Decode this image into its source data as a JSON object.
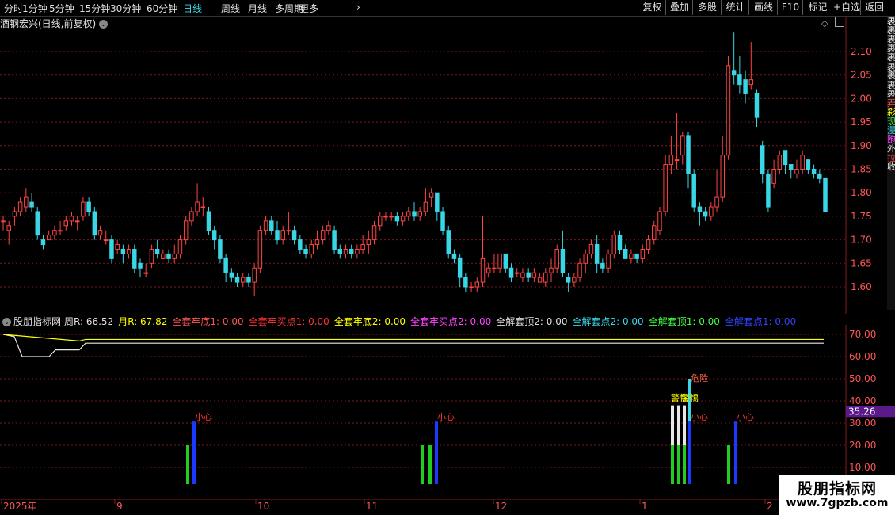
{
  "toolbar": {
    "periods": [
      "分时",
      "1分钟",
      "5分钟",
      "15分钟",
      "30分钟",
      "60分钟",
      "日线",
      "周线",
      "月线",
      "多周期",
      "更多"
    ],
    "active": "日线",
    "more_arrow": "›",
    "right_buttons": [
      "复权",
      "叠加",
      "多股",
      "统计",
      "画线",
      "F10",
      "标记",
      "+自选",
      "返回"
    ]
  },
  "main_chart": {
    "title": "酒钢宏兴(日线,前复权)",
    "price_ticks": [
      "2.10",
      "2.05",
      "2.00",
      "1.95",
      "1.90",
      "1.85",
      "1.80",
      "1.75",
      "1.70",
      "1.65",
      "1.60"
    ],
    "side_text": "裹裹裹裹裹裹裹裹裹弄彩现漫跑外拉收"
  },
  "indicator": {
    "name": "股朋指标网",
    "fields": [
      {
        "label": "周R: 66.52",
        "color": "#e0e0e0"
      },
      {
        "label": "月R: 67.82",
        "color": "#ffff00"
      },
      {
        "label": "全套牢底1: 0.00",
        "color": "#ff5555"
      },
      {
        "label": "全套牢买点1: 0.00",
        "color": "#ff3333"
      },
      {
        "label": "全套牢底2: 0.00",
        "color": "#ffff00"
      },
      {
        "label": "全套牢买点2: 0.00",
        "color": "#ff44ff"
      },
      {
        "label": "全解套顶2: 0.00",
        "color": "#e0e0e0"
      },
      {
        "label": "全解套点2: 0.00",
        "color": "#39d7e6"
      },
      {
        "label": "全解套顶1: 0.00",
        "color": "#44ff44"
      },
      {
        "label": "全解套点1: 0.00",
        "color": "#3344ff"
      }
    ],
    "ticks": [
      "70.00",
      "60.00",
      "50.00",
      "40.00",
      "30.00",
      "20.00",
      "10.00"
    ],
    "current_value": "35.26",
    "labels": {
      "careful": "小心",
      "danger": "危险",
      "alert": "警惕"
    }
  },
  "date_axis": {
    "labels": [
      "2025年",
      "9",
      "10",
      "11",
      "12",
      "1",
      "2"
    ]
  },
  "watermark": {
    "line1": "股朋指标网",
    "line2": "www.7gpzb.com"
  },
  "colors": {
    "up": "#ff4444",
    "down": "#39d7e6",
    "grid": "#7a1a1a",
    "yellow": "#ffff00",
    "white": "#e8e8e8",
    "green": "#22cc22",
    "blue": "#1a3aff"
  },
  "chart_data": {
    "type": "candlestick",
    "ylim": [
      1.57,
      2.14
    ],
    "candles": [
      [
        1.74,
        1.74,
        1.72,
        1.75
      ],
      [
        1.72,
        1.73,
        1.69,
        1.74
      ],
      [
        1.75,
        1.76,
        1.73,
        1.77
      ],
      [
        1.76,
        1.78,
        1.75,
        1.79
      ],
      [
        1.77,
        1.79,
        1.76,
        1.81
      ],
      [
        1.78,
        1.77,
        1.76,
        1.8
      ],
      [
        1.76,
        1.71,
        1.7,
        1.77
      ],
      [
        1.7,
        1.69,
        1.68,
        1.71
      ],
      [
        1.7,
        1.71,
        1.7,
        1.72
      ],
      [
        1.71,
        1.72,
        1.7,
        1.73
      ],
      [
        1.72,
        1.72,
        1.71,
        1.74
      ],
      [
        1.73,
        1.74,
        1.72,
        1.75
      ],
      [
        1.74,
        1.75,
        1.73,
        1.76
      ],
      [
        1.74,
        1.74,
        1.72,
        1.75
      ],
      [
        1.75,
        1.78,
        1.74,
        1.79
      ],
      [
        1.78,
        1.76,
        1.75,
        1.79
      ],
      [
        1.76,
        1.71,
        1.7,
        1.77
      ],
      [
        1.71,
        1.72,
        1.7,
        1.73
      ],
      [
        1.7,
        1.7,
        1.69,
        1.72
      ],
      [
        1.7,
        1.66,
        1.65,
        1.71
      ],
      [
        1.68,
        1.69,
        1.67,
        1.7
      ],
      [
        1.68,
        1.67,
        1.65,
        1.69
      ],
      [
        1.67,
        1.68,
        1.66,
        1.69
      ],
      [
        1.68,
        1.64,
        1.63,
        1.69
      ],
      [
        1.65,
        1.64,
        1.62,
        1.66
      ],
      [
        1.63,
        1.63,
        1.62,
        1.65
      ],
      [
        1.65,
        1.68,
        1.64,
        1.69
      ],
      [
        1.68,
        1.67,
        1.66,
        1.7
      ],
      [
        1.66,
        1.67,
        1.66,
        1.68
      ],
      [
        1.67,
        1.66,
        1.65,
        1.68
      ],
      [
        1.66,
        1.67,
        1.65,
        1.69
      ],
      [
        1.67,
        1.7,
        1.66,
        1.71
      ],
      [
        1.7,
        1.74,
        1.69,
        1.75
      ],
      [
        1.74,
        1.76,
        1.73,
        1.77
      ],
      [
        1.76,
        1.78,
        1.75,
        1.82
      ],
      [
        1.77,
        1.77,
        1.75,
        1.79
      ],
      [
        1.76,
        1.72,
        1.71,
        1.77
      ],
      [
        1.72,
        1.7,
        1.68,
        1.73
      ],
      [
        1.7,
        1.66,
        1.65,
        1.71
      ],
      [
        1.66,
        1.63,
        1.61,
        1.67
      ],
      [
        1.63,
        1.62,
        1.61,
        1.64
      ],
      [
        1.62,
        1.61,
        1.6,
        1.63
      ],
      [
        1.61,
        1.62,
        1.6,
        1.63
      ],
      [
        1.62,
        1.61,
        1.6,
        1.63
      ],
      [
        1.61,
        1.64,
        1.58,
        1.65
      ],
      [
        1.64,
        1.72,
        1.63,
        1.73
      ],
      [
        1.72,
        1.74,
        1.71,
        1.75
      ],
      [
        1.74,
        1.72,
        1.71,
        1.75
      ],
      [
        1.72,
        1.7,
        1.69,
        1.74
      ],
      [
        1.7,
        1.72,
        1.69,
        1.73
      ],
      [
        1.72,
        1.72,
        1.71,
        1.76
      ],
      [
        1.72,
        1.7,
        1.69,
        1.73
      ],
      [
        1.7,
        1.68,
        1.67,
        1.71
      ],
      [
        1.68,
        1.67,
        1.66,
        1.69
      ],
      [
        1.67,
        1.69,
        1.66,
        1.7
      ],
      [
        1.69,
        1.7,
        1.68,
        1.72
      ],
      [
        1.7,
        1.72,
        1.69,
        1.73
      ],
      [
        1.72,
        1.73,
        1.71,
        1.74
      ],
      [
        1.72,
        1.68,
        1.67,
        1.73
      ],
      [
        1.68,
        1.67,
        1.66,
        1.69
      ],
      [
        1.67,
        1.68,
        1.66,
        1.69
      ],
      [
        1.68,
        1.67,
        1.66,
        1.69
      ],
      [
        1.67,
        1.68,
        1.66,
        1.69
      ],
      [
        1.68,
        1.69,
        1.67,
        1.71
      ],
      [
        1.69,
        1.7,
        1.67,
        1.72
      ],
      [
        1.7,
        1.73,
        1.69,
        1.74
      ],
      [
        1.73,
        1.75,
        1.72,
        1.76
      ],
      [
        1.75,
        1.75,
        1.74,
        1.76
      ],
      [
        1.75,
        1.75,
        1.74,
        1.76
      ],
      [
        1.75,
        1.74,
        1.73,
        1.76
      ],
      [
        1.74,
        1.75,
        1.73,
        1.76
      ],
      [
        1.75,
        1.76,
        1.74,
        1.77
      ],
      [
        1.76,
        1.75,
        1.74,
        1.78
      ],
      [
        1.75,
        1.76,
        1.74,
        1.77
      ],
      [
        1.76,
        1.78,
        1.75,
        1.81
      ],
      [
        1.79,
        1.8,
        1.77,
        1.81
      ],
      [
        1.8,
        1.76,
        1.74,
        1.8
      ],
      [
        1.76,
        1.72,
        1.71,
        1.77
      ],
      [
        1.72,
        1.67,
        1.66,
        1.73
      ],
      [
        1.67,
        1.66,
        1.65,
        1.68
      ],
      [
        1.66,
        1.62,
        1.6,
        1.67
      ],
      [
        1.62,
        1.6,
        1.59,
        1.63
      ],
      [
        1.6,
        1.6,
        1.59,
        1.61
      ],
      [
        1.6,
        1.61,
        1.59,
        1.62
      ],
      [
        1.61,
        1.66,
        1.6,
        1.75
      ],
      [
        1.63,
        1.64,
        1.62,
        1.65
      ],
      [
        1.64,
        1.64,
        1.63,
        1.67
      ],
      [
        1.64,
        1.67,
        1.63,
        1.67
      ],
      [
        1.67,
        1.64,
        1.63,
        1.67
      ],
      [
        1.64,
        1.62,
        1.61,
        1.65
      ],
      [
        1.63,
        1.63,
        1.62,
        1.64
      ],
      [
        1.62,
        1.63,
        1.61,
        1.64
      ],
      [
        1.63,
        1.62,
        1.61,
        1.64
      ],
      [
        1.62,
        1.63,
        1.61,
        1.64
      ],
      [
        1.61,
        1.62,
        1.61,
        1.63
      ],
      [
        1.61,
        1.63,
        1.6,
        1.64
      ],
      [
        1.63,
        1.64,
        1.61,
        1.66
      ],
      [
        1.64,
        1.68,
        1.63,
        1.69
      ],
      [
        1.68,
        1.63,
        1.62,
        1.72
      ],
      [
        1.62,
        1.61,
        1.59,
        1.63
      ],
      [
        1.61,
        1.62,
        1.6,
        1.63
      ],
      [
        1.62,
        1.65,
        1.61,
        1.66
      ],
      [
        1.65,
        1.67,
        1.63,
        1.68
      ],
      [
        1.67,
        1.69,
        1.66,
        1.7
      ],
      [
        1.69,
        1.65,
        1.63,
        1.71
      ],
      [
        1.65,
        1.64,
        1.63,
        1.66
      ],
      [
        1.64,
        1.67,
        1.63,
        1.68
      ],
      [
        1.67,
        1.71,
        1.66,
        1.72
      ],
      [
        1.71,
        1.68,
        1.67,
        1.72
      ],
      [
        1.68,
        1.66,
        1.66,
        1.69
      ],
      [
        1.66,
        1.67,
        1.65,
        1.68
      ],
      [
        1.67,
        1.66,
        1.65,
        1.67
      ],
      [
        1.66,
        1.68,
        1.65,
        1.69
      ],
      [
        1.68,
        1.7,
        1.67,
        1.71
      ],
      [
        1.7,
        1.73,
        1.69,
        1.74
      ],
      [
        1.72,
        1.76,
        1.71,
        1.77
      ],
      [
        1.76,
        1.86,
        1.75,
        1.88
      ],
      [
        1.86,
        1.88,
        1.84,
        1.92
      ],
      [
        1.87,
        1.87,
        1.85,
        1.97
      ],
      [
        1.88,
        1.92,
        1.86,
        1.93
      ],
      [
        1.92,
        1.84,
        1.81,
        1.93
      ],
      [
        1.84,
        1.77,
        1.76,
        1.85
      ],
      [
        1.77,
        1.76,
        1.73,
        1.78
      ],
      [
        1.76,
        1.75,
        1.74,
        1.77
      ],
      [
        1.75,
        1.77,
        1.74,
        1.78
      ],
      [
        1.77,
        1.79,
        1.76,
        1.85
      ],
      [
        1.79,
        1.88,
        1.78,
        1.92
      ],
      [
        1.88,
        2.07,
        1.87,
        2.09
      ],
      [
        2.06,
        2.05,
        2.03,
        2.14
      ],
      [
        2.05,
        2.03,
        2.01,
        2.09
      ],
      [
        2.04,
        2.01,
        1.99,
        2.06
      ],
      [
        2.03,
        2.04,
        2.02,
        2.12
      ],
      [
        2.01,
        1.96,
        1.94,
        2.02
      ],
      [
        1.9,
        1.84,
        1.82,
        1.91
      ],
      [
        1.84,
        1.77,
        1.76,
        1.85
      ],
      [
        1.82,
        1.85,
        1.81,
        1.87
      ],
      [
        1.85,
        1.88,
        1.84,
        1.89
      ],
      [
        1.89,
        1.86,
        1.84,
        1.89
      ],
      [
        1.86,
        1.85,
        1.83,
        1.86
      ],
      [
        1.84,
        1.85,
        1.83,
        1.87
      ],
      [
        1.85,
        1.88,
        1.84,
        1.89
      ],
      [
        1.87,
        1.85,
        1.84,
        1.87
      ],
      [
        1.85,
        1.84,
        1.83,
        1.86
      ],
      [
        1.84,
        1.83,
        1.82,
        1.85
      ],
      [
        1.83,
        1.76,
        1.76,
        1.83
      ]
    ],
    "indicator_lines": {
      "white_start": [
        68,
        64,
        60,
        60,
        63,
        66,
        66,
        67,
        67
      ],
      "yellow": [
        67,
        67,
        67,
        67,
        67,
        67,
        67,
        67,
        67
      ]
    }
  }
}
